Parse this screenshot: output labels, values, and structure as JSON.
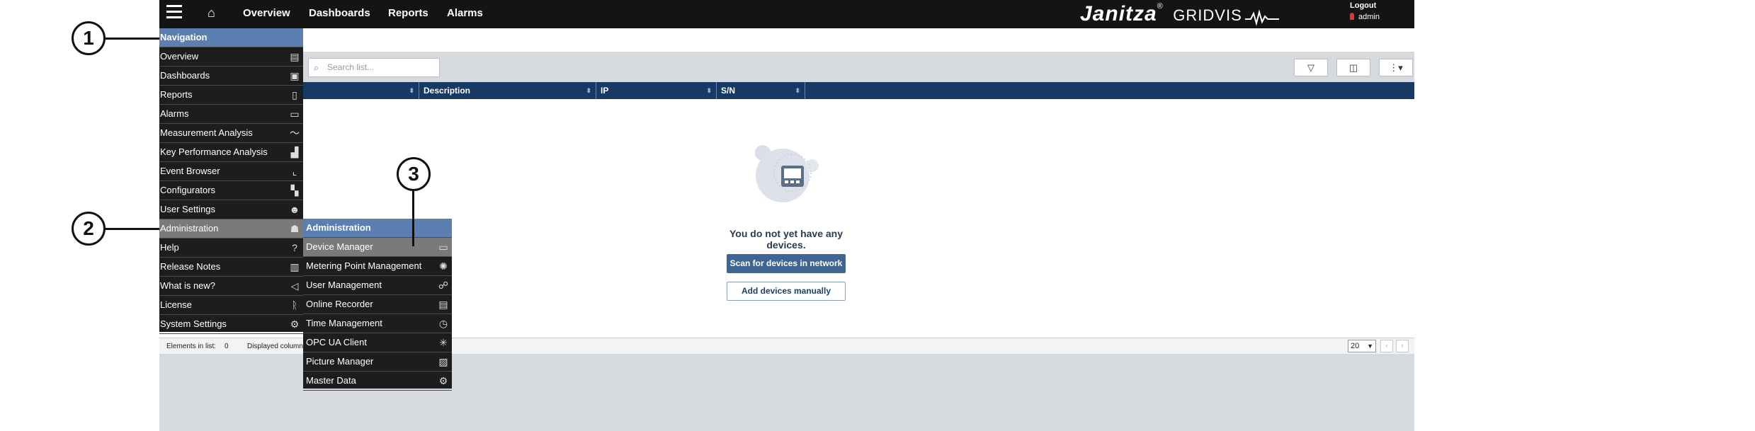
{
  "topbar": {
    "menu_icon": "hamburger-icon",
    "home_icon": "home-icon",
    "nav": [
      "Overview",
      "Dashboards",
      "Reports",
      "Alarms"
    ],
    "brand": "Janitza",
    "brand_reg": "®",
    "product": "GRIDVIS",
    "logout": "Logout",
    "user": "admin",
    "user_icon": "user-icon"
  },
  "navigation": {
    "title": "Navigation",
    "items": [
      {
        "label": "Overview",
        "icon": "overview-icon",
        "glyph": "▤"
      },
      {
        "label": "Dashboards",
        "icon": "dashboard-icon",
        "glyph": "▣"
      },
      {
        "label": "Reports",
        "icon": "report-icon",
        "glyph": "▯"
      },
      {
        "label": "Alarms",
        "icon": "alarm-icon",
        "glyph": "▭"
      },
      {
        "label": "Measurement Analysis",
        "icon": "line-chart-icon",
        "glyph": "〜"
      },
      {
        "label": "Key Performance Analysis",
        "icon": "bar-chart-icon",
        "glyph": "▟"
      },
      {
        "label": "Event Browser",
        "icon": "event-chart-icon",
        "glyph": "⌞"
      },
      {
        "label": "Configurators",
        "icon": "configurator-icon",
        "glyph": "▚"
      },
      {
        "label": "User Settings",
        "icon": "user-settings-icon",
        "glyph": "☻"
      },
      {
        "label": "Administration",
        "icon": "admin-icon",
        "glyph": "☗",
        "active": true
      },
      {
        "label": "Help",
        "icon": "help-icon",
        "glyph": "?"
      },
      {
        "label": "Release Notes",
        "icon": "book-icon",
        "glyph": "▥"
      },
      {
        "label": "What is new?",
        "icon": "megaphone-icon",
        "glyph": "◁"
      },
      {
        "label": "License",
        "icon": "license-icon",
        "glyph": "ᚱ"
      },
      {
        "label": "System Settings",
        "icon": "system-settings-icon",
        "glyph": "⚙"
      }
    ]
  },
  "submenu": {
    "title": "Administration",
    "items": [
      {
        "label": "Device Manager",
        "icon": "device-manager-icon",
        "glyph": "▭",
        "active": true
      },
      {
        "label": "Metering Point Management",
        "icon": "metering-point-icon",
        "glyph": "✺"
      },
      {
        "label": "User Management",
        "icon": "users-icon",
        "glyph": "☍"
      },
      {
        "label": "Online Recorder",
        "icon": "recorder-icon",
        "glyph": "▤"
      },
      {
        "label": "Time Management",
        "icon": "time-icon",
        "glyph": "◷"
      },
      {
        "label": "OPC UA Client",
        "icon": "opc-icon",
        "glyph": "✳"
      },
      {
        "label": "Picture Manager",
        "icon": "picture-icon",
        "glyph": "▨"
      },
      {
        "label": "Master Data",
        "icon": "master-data-icon",
        "glyph": "⚙"
      }
    ]
  },
  "toolbar": {
    "search_placeholder": "Search list...",
    "filter_icon": "filter-icon",
    "columns_icon": "columns-icon",
    "more_icon": "more-menu-icon"
  },
  "table": {
    "columns": [
      "",
      "Description",
      "IP",
      "S/N"
    ]
  },
  "empty_state": {
    "icon": "device-placeholder-icon",
    "message": "You do not yet have any devices.",
    "scan_button": "Scan for devices in network",
    "add_button": "Add devices manually"
  },
  "footer": {
    "elements_label": "Elements in list:",
    "elements_count": "0",
    "displayed_columns": "Displayed column",
    "page_size": "20"
  },
  "callouts": [
    "1",
    "2",
    "3"
  ]
}
